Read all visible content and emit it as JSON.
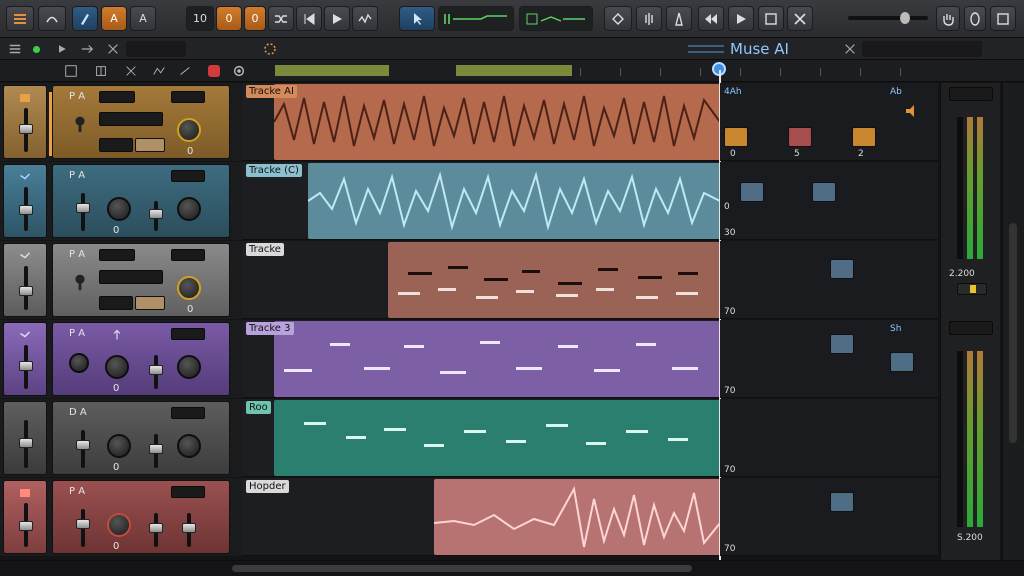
{
  "toolbar": {
    "lcd": [
      "10",
      "0",
      "0"
    ],
    "modes": [
      "A",
      "A"
    ]
  },
  "secbar": {
    "brand": "Muse AI"
  },
  "tracks": [
    {
      "name": "Tracke AI",
      "value": "0",
      "color": "#a77a3a",
      "clip": "#b5694d"
    },
    {
      "name": "Tracke (C)",
      "value": "0",
      "color": "#3e6c80",
      "clip": "#5c8c9c"
    },
    {
      "name": "Tracke",
      "value": "0",
      "color": "#7a7a7a",
      "clip": "#9a6355"
    },
    {
      "name": "Tracke 3",
      "value": "0",
      "color": "#7a5aa6",
      "clip": "#7d5fa6"
    },
    {
      "name": "Roo",
      "value": "0",
      "color": "#5a5a5a",
      "clip": "#2b7f6e"
    },
    {
      "name": "Hopder",
      "value": "0",
      "color": "#9a5050",
      "clip": "#b77272"
    }
  ],
  "launcher": {
    "row1": [
      "0",
      "5",
      "2"
    ],
    "top_label": "4Ah",
    "right_label": "Ab",
    "mid_label": "Sh",
    "scale_labels": [
      "0",
      "30",
      "70",
      "70",
      "70",
      "70"
    ]
  },
  "meters": {
    "top_label": "2.200",
    "bottom_label": "S.200",
    "scale": [
      "10",
      "10",
      "16",
      "10",
      "10",
      "10",
      "10",
      "10",
      "10",
      "10",
      "10"
    ]
  }
}
